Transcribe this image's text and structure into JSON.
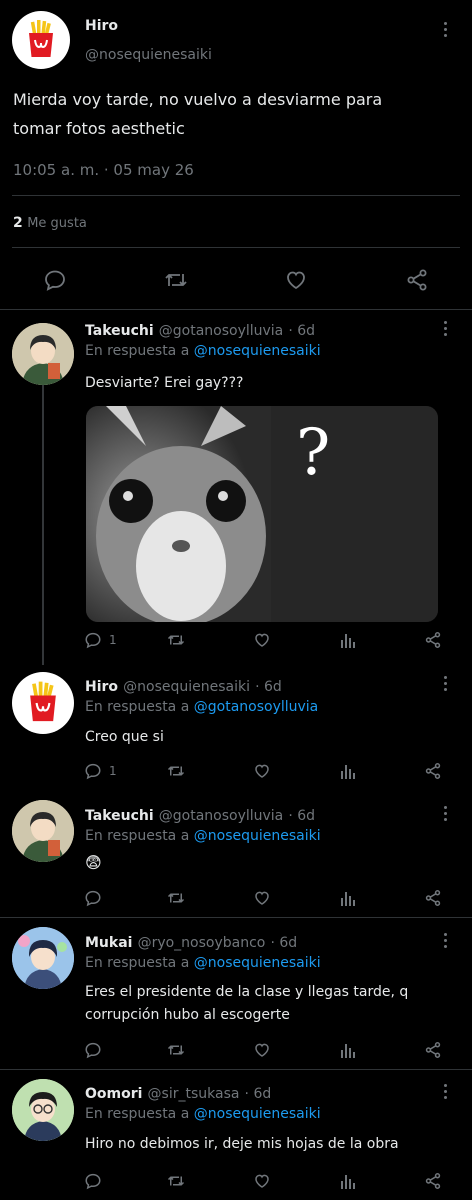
{
  "main_tweet": {
    "display_name": "Hiro",
    "handle": "@nosequienesaiki",
    "text_line1": "Mierda voy tarde, no vuelvo a desviarme para",
    "text_line2": "tomar fotos aesthetic",
    "timestamp": "10:05 a. m. · 05 may 26",
    "likes_count": "2",
    "likes_label": "Me gusta"
  },
  "replies": [
    {
      "display_name": "Takeuchi",
      "handle": "@gotanosoylluvia",
      "age": "· 6d",
      "reply_prefix": "En respuesta a",
      "reply_to": "@nosequienesaiki",
      "text": "Desviarte? Erei gay???",
      "reply_count": "1"
    },
    {
      "display_name": "Hiro",
      "handle": "@nosequienesaiki",
      "age": "· 6d",
      "reply_prefix": "En respuesta a",
      "reply_to": "@gotanosoylluvia",
      "text": "Creo que si",
      "reply_count": "1"
    },
    {
      "display_name": "Takeuchi",
      "handle": "@gotanosoylluvia",
      "age": "· 6d",
      "reply_prefix": "En respuesta a",
      "reply_to": "@nosequienesaiki",
      "text": "😨"
    },
    {
      "display_name": "Mukai",
      "handle": "@ryo_nosoybanco",
      "age": "· 6d",
      "reply_prefix": "En respuesta a",
      "reply_to": "@nosequienesaiki",
      "text_line1": "Eres el presidente de la clase y llegas tarde, q",
      "text_line2": "corrupción hubo al escogerte"
    },
    {
      "display_name": "Oomori",
      "handle": "@sir_tsukasa",
      "age": "· 6d",
      "reply_prefix": "En respuesta a",
      "reply_to": "@nosequienesaiki",
      "text": "Hiro no debimos ir, deje mis hojas de la obra"
    }
  ],
  "media": {
    "overlay_symbol": "?"
  },
  "colors": {
    "background": "#000000",
    "link": "#1d9bf0",
    "muted": "#71767b",
    "divider": "#2f3336"
  },
  "icons": [
    "more-icon",
    "reply-icon",
    "retweet-icon",
    "like-icon",
    "share-icon",
    "views-icon"
  ]
}
